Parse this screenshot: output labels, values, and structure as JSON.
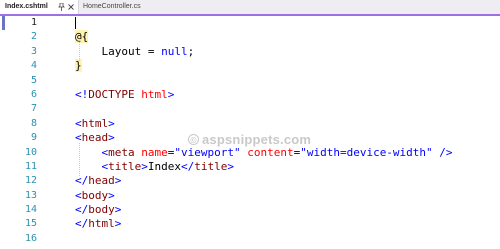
{
  "tabs": {
    "active_label": "Index.cshtml",
    "inactive_label": "HomeController.cs",
    "pin_icon": "pin-icon",
    "close_icon": "close-icon"
  },
  "watermark": {
    "text": "aspsnippets.com",
    "icon": "copyright-icon",
    "icon_glyph": "©"
  },
  "colors": {
    "line_number": "#2b91af",
    "razor_at": "#000000",
    "razor_highlight": "#fff3b0",
    "keyword": "#0000ff",
    "tag": "#800000",
    "attribute": "#ff0000",
    "string": "#0000ff",
    "active_tab_accent": "#9f6fe3"
  },
  "lines": [
    {
      "num": "1",
      "tokens": []
    },
    {
      "num": "2",
      "tokens": [
        {
          "t": "@{",
          "c": "razor"
        }
      ]
    },
    {
      "num": "3",
      "tokens": [
        {
          "t": "    Layout = ",
          "c": "plain"
        },
        {
          "t": "null",
          "c": "keyword"
        },
        {
          "t": ";",
          "c": "plain"
        }
      ]
    },
    {
      "num": "4",
      "tokens": [
        {
          "t": "}",
          "c": "razor"
        }
      ]
    },
    {
      "num": "5",
      "tokens": []
    },
    {
      "num": "6",
      "tokens": [
        {
          "t": "<!",
          "c": "bracket"
        },
        {
          "t": "DOCTYPE",
          "c": "tag"
        },
        {
          "t": " html",
          "c": "attr"
        },
        {
          "t": ">",
          "c": "bracket"
        }
      ]
    },
    {
      "num": "7",
      "tokens": []
    },
    {
      "num": "8",
      "tokens": [
        {
          "t": "<",
          "c": "bracket"
        },
        {
          "t": "html",
          "c": "tag"
        },
        {
          "t": ">",
          "c": "bracket"
        }
      ]
    },
    {
      "num": "9",
      "tokens": [
        {
          "t": "<",
          "c": "bracket"
        },
        {
          "t": "head",
          "c": "tag"
        },
        {
          "t": ">",
          "c": "bracket"
        }
      ]
    },
    {
      "num": "10",
      "tokens": [
        {
          "t": "    <",
          "c": "bracket"
        },
        {
          "t": "meta",
          "c": "tag"
        },
        {
          "t": " name",
          "c": "attr"
        },
        {
          "t": "=",
          "c": "plain"
        },
        {
          "t": "\"viewport\"",
          "c": "string"
        },
        {
          "t": " content",
          "c": "attr"
        },
        {
          "t": "=",
          "c": "plain"
        },
        {
          "t": "\"width=device-width\"",
          "c": "string"
        },
        {
          "t": " />",
          "c": "bracket"
        }
      ]
    },
    {
      "num": "11",
      "tokens": [
        {
          "t": "    <",
          "c": "bracket"
        },
        {
          "t": "title",
          "c": "tag"
        },
        {
          "t": ">",
          "c": "bracket"
        },
        {
          "t": "Index",
          "c": "plain"
        },
        {
          "t": "</",
          "c": "bracket"
        },
        {
          "t": "title",
          "c": "tag"
        },
        {
          "t": ">",
          "c": "bracket"
        }
      ]
    },
    {
      "num": "12",
      "tokens": [
        {
          "t": "</",
          "c": "bracket"
        },
        {
          "t": "head",
          "c": "tag"
        },
        {
          "t": ">",
          "c": "bracket"
        }
      ]
    },
    {
      "num": "13",
      "tokens": [
        {
          "t": "<",
          "c": "bracket"
        },
        {
          "t": "body",
          "c": "tag"
        },
        {
          "t": ">",
          "c": "bracket"
        }
      ]
    },
    {
      "num": "14",
      "tokens": [
        {
          "t": "</",
          "c": "bracket"
        },
        {
          "t": "body",
          "c": "tag"
        },
        {
          "t": ">",
          "c": "bracket"
        }
      ]
    },
    {
      "num": "15",
      "tokens": [
        {
          "t": "</",
          "c": "bracket"
        },
        {
          "t": "html",
          "c": "tag"
        },
        {
          "t": ">",
          "c": "bracket"
        }
      ]
    },
    {
      "num": "16",
      "tokens": []
    }
  ]
}
